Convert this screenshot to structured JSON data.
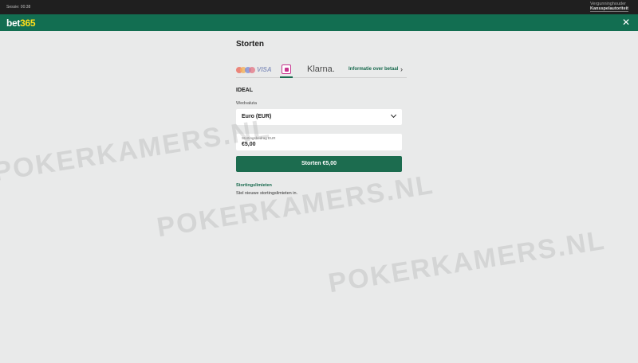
{
  "topbar": {
    "session": "Sessie: 00:38",
    "license_line1": "Vergunninghouder",
    "license_line2": "Kansspelautoriteit"
  },
  "header": {
    "logo_main": "bet",
    "logo_num": "365"
  },
  "deposit": {
    "title": "Storten",
    "methods": {
      "visa": "VISA",
      "klarna": "Klarna.",
      "info_link": "Informatie over betaal"
    },
    "section": "IDEAL",
    "currency_label": "Wedvaluta",
    "currency_value": "Euro (EUR)",
    "amount_label": "Stortingsbedrag EUR",
    "amount_value": "€5,00",
    "button_label": "Storten €5,00",
    "limits_link": "Stortingslimieten",
    "limits_text": "Stel nieuwe stortingslimieten in."
  },
  "watermark": "POKERKAMERS.NL",
  "colors": {
    "brand_green": "#126e51",
    "button_green": "#1c6c4f",
    "logo_yellow": "#ffdf1b",
    "background": "#e9eaea"
  },
  "icons": [
    "close-icon",
    "mastercard-icon",
    "maestro-icon",
    "ideal-icon",
    "chevron-right-icon",
    "chevron-down-icon"
  ]
}
